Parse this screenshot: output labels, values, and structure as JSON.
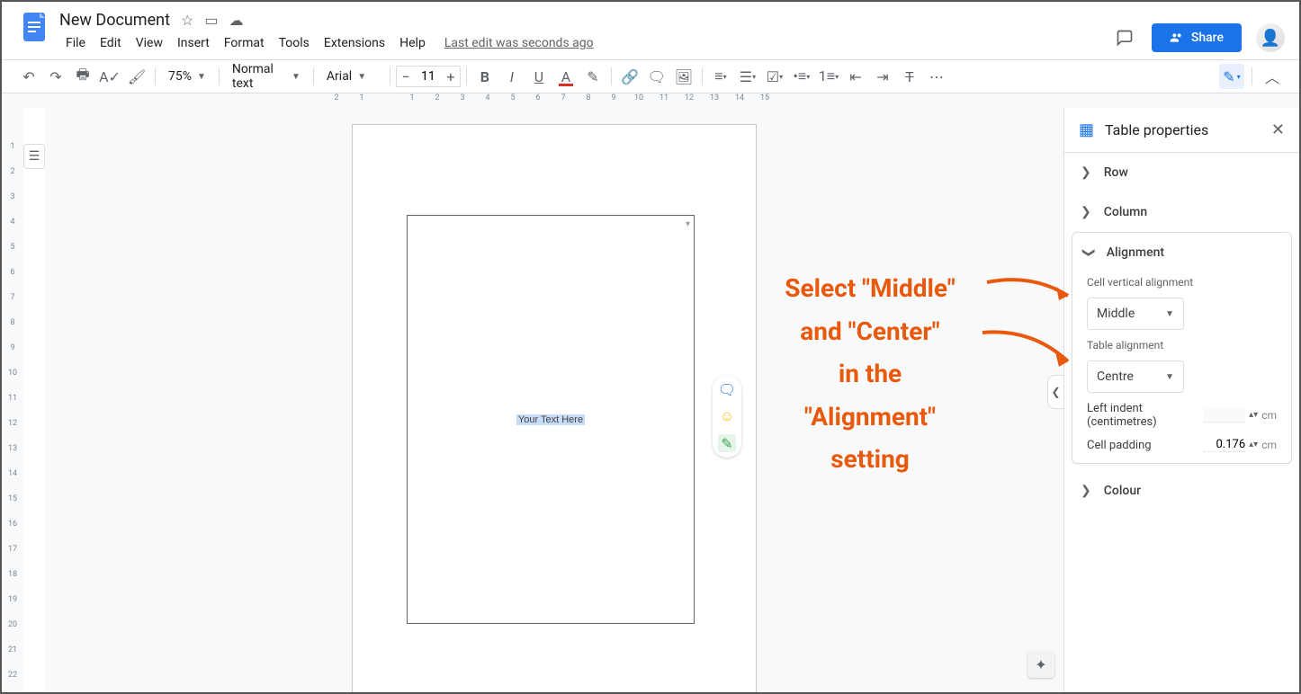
{
  "header": {
    "doc_title": "New Document",
    "menus": [
      "File",
      "Edit",
      "View",
      "Insert",
      "Format",
      "Tools",
      "Extensions",
      "Help"
    ],
    "last_edit": "Last edit was seconds ago",
    "share_label": "Share"
  },
  "toolbar": {
    "zoom": "75%",
    "style": "Normal text",
    "font": "Arial",
    "font_size": "11"
  },
  "ruler": {
    "top": [
      "2",
      "1",
      "",
      "1",
      "2",
      "3",
      "4",
      "5",
      "6",
      "7",
      "8",
      "9",
      "10",
      "11",
      "12",
      "13",
      "14",
      "15"
    ],
    "left": [
      "",
      "1",
      "2",
      "3",
      "4",
      "5",
      "6",
      "7",
      "8",
      "9",
      "10",
      "11",
      "12",
      "13",
      "14",
      "15",
      "16",
      "17",
      "18",
      "19",
      "20",
      "21",
      "22"
    ]
  },
  "page": {
    "cell_text": "Your Text Here"
  },
  "annotation": {
    "line1": "Select \"Middle\"",
    "line2": "and \"Center\"",
    "line3": "in the",
    "line4": "\"Alignment\"",
    "line5": "setting"
  },
  "sidebar": {
    "title": "Table properties",
    "sections": {
      "row": "Row",
      "column": "Column",
      "alignment": "Alignment",
      "colour": "Colour"
    },
    "alignment": {
      "cell_vertical_label": "Cell vertical alignment",
      "cell_vertical_value": "Middle",
      "table_label": "Table alignment",
      "table_value": "Centre",
      "left_indent_label": "Left indent (centimetres)",
      "left_indent_unit": "cm",
      "cell_padding_label": "Cell padding",
      "cell_padding_value": "0.176",
      "cell_padding_unit": "cm"
    }
  }
}
